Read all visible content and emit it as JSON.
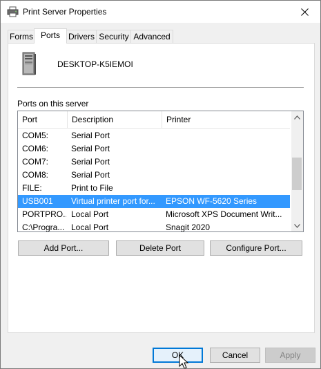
{
  "window": {
    "title": "Print Server Properties"
  },
  "tabs": [
    {
      "label": "Forms"
    },
    {
      "label": "Ports"
    },
    {
      "label": "Drivers"
    },
    {
      "label": "Security"
    },
    {
      "label": "Advanced"
    }
  ],
  "active_tab": "Ports",
  "server": {
    "name": "DESKTOP-K5IEMOI",
    "icon": "server-computer-icon"
  },
  "ports_label": "Ports on this server",
  "columns": [
    "Port",
    "Description",
    "Printer"
  ],
  "rows": [
    {
      "port": "COM5:",
      "description": "Serial Port",
      "printer": ""
    },
    {
      "port": "COM6:",
      "description": "Serial Port",
      "printer": ""
    },
    {
      "port": "COM7:",
      "description": "Serial Port",
      "printer": ""
    },
    {
      "port": "COM8:",
      "description": "Serial Port",
      "printer": ""
    },
    {
      "port": "FILE:",
      "description": "Print to File",
      "printer": ""
    },
    {
      "port": "USB001",
      "description": "Virtual printer port for...",
      "printer": "EPSON WF-5620 Series"
    },
    {
      "port": "PORTPRO...",
      "description": "Local Port",
      "printer": "Microsoft XPS Document Writ..."
    },
    {
      "port": "C:\\Progra...",
      "description": "Local Port",
      "printer": "Snagit 2020"
    }
  ],
  "selected_row": "USB001",
  "buttons": {
    "add_port": "Add Port...",
    "delete_port": "Delete Port",
    "configure_port": "Configure Port...",
    "ok": "OK",
    "cancel": "Cancel",
    "apply": "Apply"
  },
  "colors": {
    "selection": "#3399ff",
    "default_button_border": "#0078d7"
  }
}
